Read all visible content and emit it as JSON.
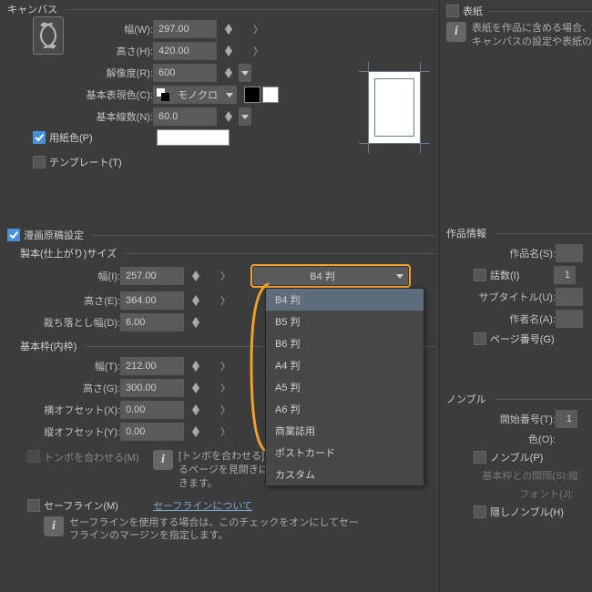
{
  "canvas": {
    "title": "キャンバス",
    "width_label": "幅(W):",
    "width": "297.00",
    "height_label": "高さ(H):",
    "height": "420.00",
    "resolution_label": "解像度(R):",
    "resolution": "600",
    "colormode_label": "基本表現色(C):",
    "colormode": "モノクロ",
    "lines_label": "基本線数(N):",
    "lines": "60.0",
    "papercolor_label": "用紙色(P)",
    "template_label": "テンプレート(T)"
  },
  "manga": {
    "title": "漫画原稿設定",
    "finish_group": "製本(仕上がり)サイズ",
    "width_label": "幅(I):",
    "width": "257.00",
    "height_label": "高さ(E):",
    "height": "364.00",
    "bleed_label": "裁ち落とし幅(D):",
    "bleed": "6.00",
    "preset_selected": "B4 判",
    "preset_options": [
      "B4 判",
      "B5 判",
      "B6 判",
      "A4 判",
      "A5 判",
      "A6 判",
      "商業誌用",
      "ポストカード",
      "カスタム"
    ],
    "frame_group": "基本枠(内枠)",
    "frame_width_label": "幅(T):",
    "frame_width": "212.00",
    "frame_height_label": "高さ(G):",
    "frame_height": "300.00",
    "offx_label": "横オフセット(X):",
    "offx": "0.00",
    "offy_label": "縦オフセット(Y):",
    "offy": "0.00",
    "tombo_label": "トンボを合わせる(M)",
    "tombo_info": "[トンボを合わせる]は、[複数ページ]の設定で[対するページを見開きにする]をオンにした時に設定できます。",
    "safeline_label": "セーフライン(M)",
    "safeline_link": "セーフラインについて",
    "safeline_info": "セーフラインを使用する場合は、このチェックをオンにしてセーフラインのマージンを指定します。"
  },
  "cover": {
    "title": "表紙",
    "info": "表紙を作品に含める場合、キャンバスの設定や表紙の"
  },
  "work": {
    "title": "作品情報",
    "name_label": "作品名(S):",
    "episodes_label": "話数(I)",
    "episodes": "1",
    "subtitle_label": "サブタイトル(U):",
    "author_label": "作者名(A):",
    "pagenum_label": "ページ番号(G)"
  },
  "nombre": {
    "title": "ノンブル",
    "start_label": "開始番号(T):",
    "start": "1",
    "color_label": "色(O):",
    "nombre_label": "ノンブル(P)",
    "gap_label": "基本枠との間隔(S):",
    "gap_suffix": "縦",
    "font_label": "フォント(J):",
    "hidden_label": "隠しノンブル(H)"
  }
}
